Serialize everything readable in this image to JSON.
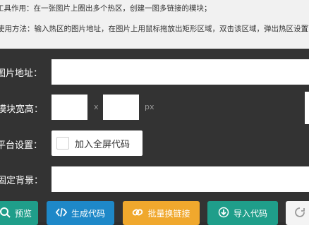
{
  "intro": {
    "line1": "工具作用：在一张图片上圈出多个热区，创建一图多链接的模块；",
    "line2": "使用方法：输入热区的图片地址，在图片上用鼠标拖放出矩形区域，双击该区域，弹出热区设置面板"
  },
  "form": {
    "image_url": {
      "label": "图片地址：",
      "value": ""
    },
    "size": {
      "label": "模块宽高：",
      "width": "",
      "height": "",
      "separator": "x",
      "unit": "px"
    },
    "platform": {
      "label": "平台设置：",
      "checkbox_label": "加入全屏代码",
      "checked": false
    },
    "background": {
      "label": "固定背景：",
      "value": ""
    }
  },
  "buttons": {
    "preview": {
      "label": "预览",
      "color": "#1f9e8a",
      "icon": "search-icon"
    },
    "generate": {
      "label": "生成代码",
      "color": "#1e88c8",
      "icon": "code-icon"
    },
    "batch": {
      "label": "批量换链接",
      "color": "#f0a82d",
      "icon": "link-icon"
    },
    "import": {
      "label": "导入代码",
      "color": "#1f9e8a",
      "icon": "import-icon"
    }
  }
}
